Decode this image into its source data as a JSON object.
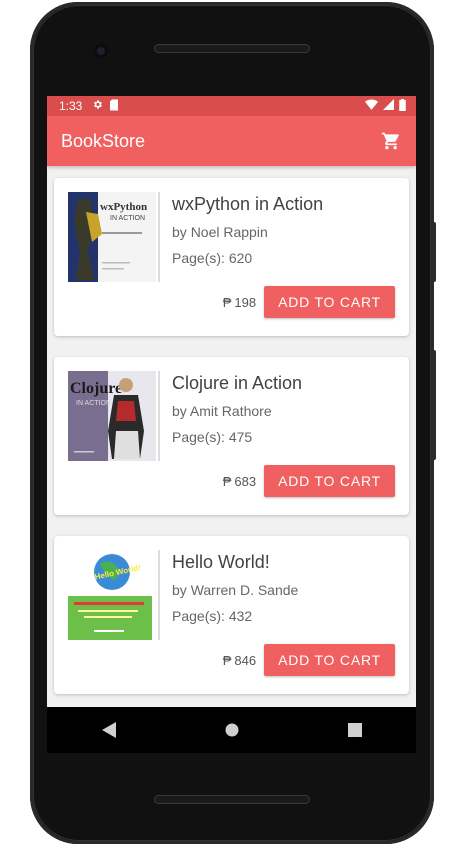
{
  "status_bar": {
    "time": "1:33"
  },
  "app_bar": {
    "title": "BookStore",
    "cart_icon": "shopping-cart-icon"
  },
  "books": [
    {
      "title": "wxPython in Action",
      "author_prefix": "by",
      "author": "Noel Rappin",
      "pages_label": "Page(s):",
      "pages": "620",
      "currency": "₱",
      "price": "198",
      "button": "ADD TO CART",
      "cover_text": "wxPython in Action"
    },
    {
      "title": "Clojure in Action",
      "author_prefix": "by",
      "author": "Amit Rathore",
      "pages_label": "Page(s):",
      "pages": "475",
      "currency": "₱",
      "price": "683",
      "button": "ADD TO CART",
      "cover_text": "Clojure in Action"
    },
    {
      "title": "Hello World!",
      "author_prefix": "by",
      "author": "Warren D. Sande",
      "pages_label": "Page(s):",
      "pages": "432",
      "currency": "₱",
      "price": "846",
      "button": "ADD TO CART",
      "cover_text": "Hello World!"
    }
  ],
  "colors": {
    "accent": "#f06060",
    "status": "#d94d4d",
    "background": "#f1f1f1"
  }
}
